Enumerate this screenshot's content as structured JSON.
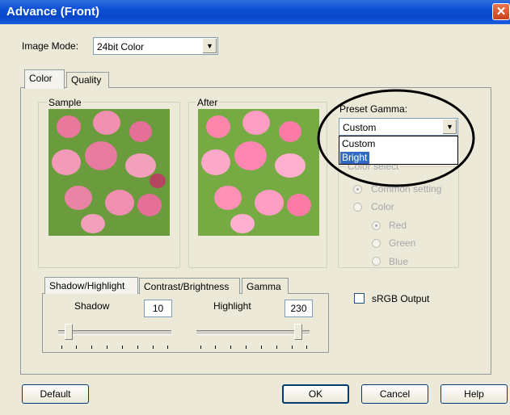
{
  "window": {
    "title": "Advance (Front)",
    "close_glyph": "✕"
  },
  "image_mode": {
    "label": "Image Mode:",
    "value": "24bit Color"
  },
  "main_tabs": [
    "Color",
    "Quality"
  ],
  "sample": {
    "label": "Sample"
  },
  "after": {
    "label": "After"
  },
  "preset_gamma": {
    "label": "Preset Gamma:",
    "value": "Custom",
    "options": [
      "Custom",
      "Bright"
    ],
    "highlighted": "Bright"
  },
  "color_select": {
    "label": "Color select",
    "common_setting": "Common setting",
    "color": "Color",
    "red": "Red",
    "green": "Green",
    "blue": "Blue"
  },
  "adjust_tabs": [
    "Shadow/Highlight",
    "Contrast/Brightness",
    "Gamma"
  ],
  "shadow": {
    "label": "Shadow",
    "value": "10",
    "level": 10
  },
  "highlight": {
    "label": "Highlight",
    "value": "230",
    "level": 230
  },
  "srgb_output": {
    "label": "sRGB Output",
    "checked": false
  },
  "buttons": {
    "default": "Default",
    "ok": "OK",
    "cancel": "Cancel",
    "help": "Help"
  },
  "icons": {
    "dropdown": "chevron-down-icon",
    "close": "close-icon"
  },
  "colors": {
    "title_bar": "#0a4fd4",
    "selection": "#316ac5",
    "highlight_circle": "#000000"
  }
}
